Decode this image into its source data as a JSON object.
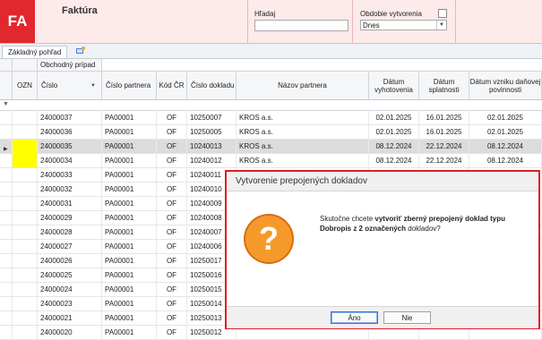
{
  "app": {
    "logo": "FA",
    "title": "Faktúra"
  },
  "search": {
    "label": "Hľadaj",
    "value": ""
  },
  "period": {
    "label": "Obdobie vytvorenia",
    "value": "Dnes"
  },
  "tabs": [
    {
      "label": "Základný pohľad"
    }
  ],
  "table": {
    "group_header": "Obchodný prípad",
    "columns": {
      "ozn": "OZN",
      "cislo": "Číslo",
      "cislo_partnera": "Číslo partnera",
      "kod_cr": "Kód ČR",
      "cislo_dokladu": "Číslo dokladu",
      "nazov_partnera": "Názov partnera",
      "datum_vyhotovenia": "Dátum vyhotovenia",
      "datum_splatnosti": "Dátum splatnosti",
      "datum_dph": "Dátum vzniku daňovej povinnosti"
    },
    "rows": [
      {
        "cislo": "24000037",
        "partner": "PA00001",
        "kod": "OF",
        "doklad": "10250007",
        "nazov": "KROS a.s.",
        "vyhot": "02.01.2025",
        "splat": "16.01.2025",
        "dph": "02.01.2025",
        "marked": false,
        "selected": false
      },
      {
        "cislo": "24000036",
        "partner": "PA00001",
        "kod": "OF",
        "doklad": "10250005",
        "nazov": "KROS a.s.",
        "vyhot": "02.01.2025",
        "splat": "16.01.2025",
        "dph": "02.01.2025",
        "marked": false,
        "selected": false
      },
      {
        "cislo": "24000035",
        "partner": "PA00001",
        "kod": "OF",
        "doklad": "10240013",
        "nazov": "KROS a.s.",
        "vyhot": "08.12.2024",
        "splat": "22.12.2024",
        "dph": "08.12.2024",
        "marked": true,
        "selected": true
      },
      {
        "cislo": "24000034",
        "partner": "PA00001",
        "kod": "OF",
        "doklad": "10240012",
        "nazov": "KROS a.s.",
        "vyhot": "08.12.2024",
        "splat": "22.12.2024",
        "dph": "08.12.2024",
        "marked": true,
        "selected": false
      },
      {
        "cislo": "24000033",
        "partner": "PA00001",
        "kod": "OF",
        "doklad": "10240011",
        "nazov": "",
        "vyhot": "",
        "splat": "",
        "dph": "",
        "marked": false,
        "selected": false
      },
      {
        "cislo": "24000032",
        "partner": "PA00001",
        "kod": "OF",
        "doklad": "10240010",
        "nazov": "",
        "vyhot": "",
        "splat": "",
        "dph": "",
        "marked": false,
        "selected": false
      },
      {
        "cislo": "24000031",
        "partner": "PA00001",
        "kod": "OF",
        "doklad": "10240009",
        "nazov": "",
        "vyhot": "",
        "splat": "",
        "dph": "",
        "marked": false,
        "selected": false
      },
      {
        "cislo": "24000029",
        "partner": "PA00001",
        "kod": "OF",
        "doklad": "10240008",
        "nazov": "",
        "vyhot": "",
        "splat": "",
        "dph": "",
        "marked": false,
        "selected": false
      },
      {
        "cislo": "24000028",
        "partner": "PA00001",
        "kod": "OF",
        "doklad": "10240007",
        "nazov": "",
        "vyhot": "",
        "splat": "",
        "dph": "",
        "marked": false,
        "selected": false
      },
      {
        "cislo": "24000027",
        "partner": "PA00001",
        "kod": "OF",
        "doklad": "10240006",
        "nazov": "",
        "vyhot": "",
        "splat": "",
        "dph": "",
        "marked": false,
        "selected": false
      },
      {
        "cislo": "24000026",
        "partner": "PA00001",
        "kod": "OF",
        "doklad": "10250017",
        "nazov": "",
        "vyhot": "",
        "splat": "",
        "dph": "",
        "marked": false,
        "selected": false
      },
      {
        "cislo": "24000025",
        "partner": "PA00001",
        "kod": "OF",
        "doklad": "10250016",
        "nazov": "",
        "vyhot": "",
        "splat": "",
        "dph": "",
        "marked": false,
        "selected": false
      },
      {
        "cislo": "24000024",
        "partner": "PA00001",
        "kod": "OF",
        "doklad": "10250015",
        "nazov": "",
        "vyhot": "",
        "splat": "",
        "dph": "",
        "marked": false,
        "selected": false
      },
      {
        "cislo": "24000023",
        "partner": "PA00001",
        "kod": "OF",
        "doklad": "10250014",
        "nazov": "",
        "vyhot": "",
        "splat": "",
        "dph": "",
        "marked": false,
        "selected": false
      },
      {
        "cislo": "24000021",
        "partner": "PA00001",
        "kod": "OF",
        "doklad": "10250013",
        "nazov": "",
        "vyhot": "",
        "splat": "",
        "dph": "",
        "marked": false,
        "selected": false
      },
      {
        "cislo": "24000020",
        "partner": "PA00001",
        "kod": "OF",
        "doklad": "10250012",
        "nazov": "",
        "vyhot": "",
        "splat": "",
        "dph": "",
        "marked": false,
        "selected": false
      }
    ]
  },
  "dialog": {
    "title": "Vytvorenie prepojených dokladov",
    "msg_part1": "Skutočne chcete ",
    "msg_bold": "vytvoriť zberný prepojený doklad typu Dobropis z 2 označených",
    "msg_part2": " dokladov?",
    "icon_glyph": "?",
    "yes_label": "Áno",
    "no_label": "Nie"
  },
  "colors": {
    "brand": "#e0282e",
    "marked": "#ffff00",
    "dialog_border": "#e01c22",
    "icon": "#f08a1c"
  }
}
